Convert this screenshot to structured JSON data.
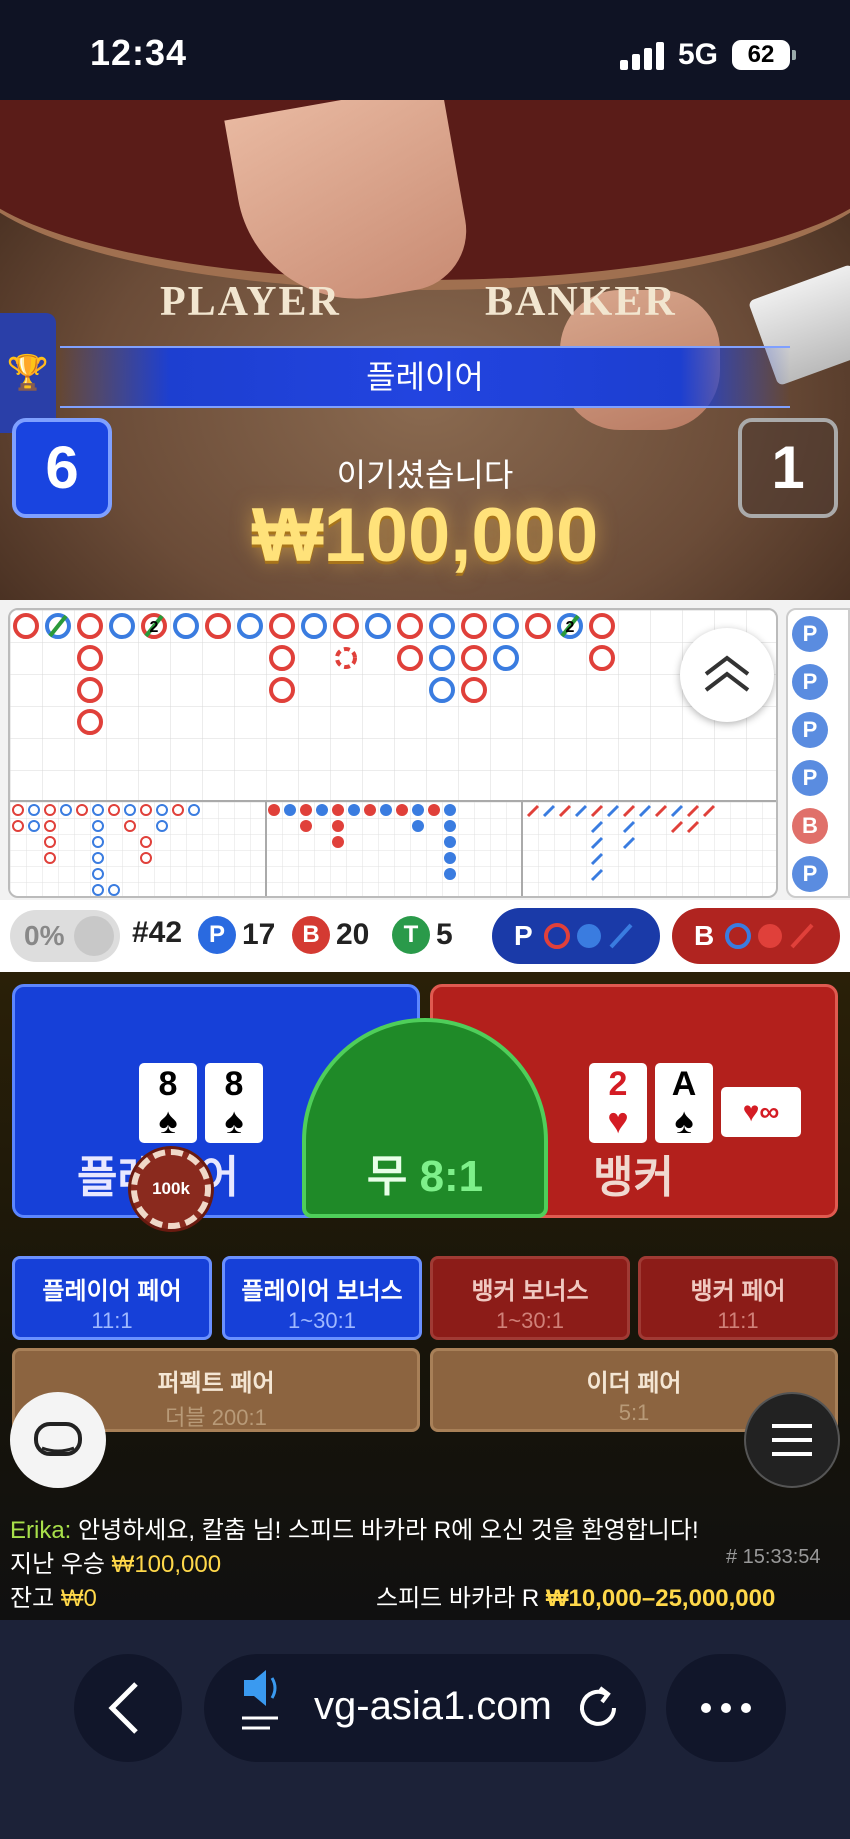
{
  "status": {
    "time": "12:34",
    "network": "5G",
    "battery": "62"
  },
  "video": {
    "table_player": "PLAYER",
    "table_banker": "BANKER",
    "result_banner": "플레이어",
    "win_label": "이기셨습니다",
    "win_amount": "₩100,000",
    "player_score": "6",
    "banker_score": "1"
  },
  "roadmap": {
    "side_beads": [
      "P",
      "P",
      "P",
      "P",
      "B",
      "P"
    ]
  },
  "stats": {
    "percent": "0%",
    "round": "#42",
    "player_badge": "P",
    "player_count": "17",
    "banker_badge": "B",
    "banker_count": "20",
    "tie_badge": "T",
    "tie_count": "5",
    "player_ask": "P",
    "banker_ask": "B"
  },
  "colors": {
    "player_blue": "#1640d8",
    "banker_red": "#b3201c",
    "tie_green": "#1f8a28",
    "gold": "#ffe27a"
  },
  "bets": {
    "player_label": "플레이어",
    "banker_label": "뱅커",
    "tie_label": "무",
    "tie_odds": "8:1",
    "chip_value": "100k",
    "player_cards": [
      {
        "rank": "8",
        "suit": "♠"
      },
      {
        "rank": "8",
        "suit": "♠"
      }
    ],
    "banker_cards": [
      {
        "rank": "2",
        "suit": "♥"
      },
      {
        "rank": "A",
        "suit": "♠"
      }
    ],
    "banker_third": "♥∞",
    "player_pair": {
      "label": "플레이어 페어",
      "odds": "11:1"
    },
    "player_bonus": {
      "label": "플레이어 보너스",
      "odds": "1~30:1"
    },
    "banker_bonus": {
      "label": "뱅커 보너스",
      "odds": "1~30:1"
    },
    "banker_pair": {
      "label": "뱅커 페어",
      "odds": "11:1"
    },
    "perfect_pair": {
      "label": "퍼펙트 페어",
      "odds": "더블 200:1"
    },
    "either_pair": {
      "label": "이더 페어",
      "odds": "5:1"
    }
  },
  "chat": {
    "user": "Erika:",
    "message": "안녕하세요, 칼춤 님! 스피드 바카라 R에 오신 것을 환영합니다!",
    "last_win_label": "지난 우승",
    "last_win_amount": "₩100,000",
    "round_id": "# 15:33:54",
    "balance_label": "잔고",
    "balance_amount": "₩0",
    "game_name": "스피드 바카라 R",
    "limits": "₩10,000–25,000,000"
  },
  "browser": {
    "url": "vg-asia1.com"
  }
}
